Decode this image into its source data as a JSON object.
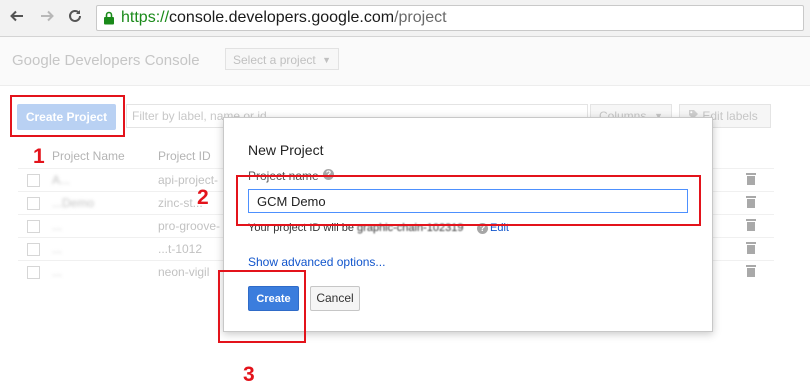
{
  "browser": {
    "url_scheme": "https://",
    "url_host": "console.developers.google.com",
    "url_path": "/project"
  },
  "header": {
    "brand": "Google Developers Console",
    "project_selector": "Select a project"
  },
  "toolbar": {
    "create_project_label": "Create Project",
    "filter_placeholder": "Filter by label, name or id",
    "columns_label": "Columns",
    "edit_labels_label": "Edit labels"
  },
  "table": {
    "columns": [
      "Project Name",
      "Project ID"
    ],
    "rows": [
      {
        "name": "A...",
        "id": "api-project-"
      },
      {
        "name": "...Demo",
        "id": "zinc-st..."
      },
      {
        "name": "...",
        "id": "pro-groove-"
      },
      {
        "name": "...",
        "id": "...t-1012"
      },
      {
        "name": "...",
        "id": "neon-vigil"
      }
    ]
  },
  "dialog": {
    "title": "New Project",
    "project_name_label": "Project name",
    "project_name_value": "GCM Demo",
    "project_id_prefix": "Your project ID will be",
    "project_id_value": "graphic-chain-102319",
    "edit_link": "Edit",
    "advanced_link": "Show advanced options...",
    "create_label": "Create",
    "cancel_label": "Cancel"
  },
  "annotations": {
    "step1": "1",
    "step2": "2",
    "step3": "3"
  },
  "colors": {
    "accent_blue": "#3b7ddd",
    "annotation_red": "#e3131b",
    "https_green": "#1a8a1a",
    "link_blue": "#1155cc"
  },
  "icons": [
    "back-icon",
    "forward-icon",
    "reload-icon",
    "lock-icon",
    "help-icon",
    "trash-icon",
    "tag-icon",
    "caret-down-icon"
  ]
}
